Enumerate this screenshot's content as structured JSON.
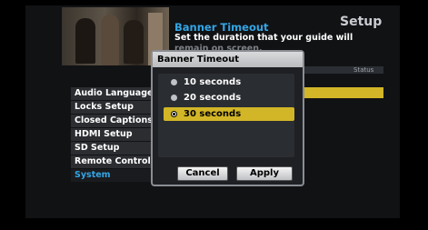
{
  "header": {
    "section_title": "Setup",
    "help_title": "Banner Timeout",
    "help_text_line1": "Set the duration that your guide will",
    "help_text_line2": "remain on screen."
  },
  "status_label": "Status",
  "menu": {
    "items": [
      {
        "label": "Audio Language"
      },
      {
        "label": "Locks Setup"
      },
      {
        "label": "Closed Captions"
      },
      {
        "label": "HDMI Setup"
      },
      {
        "label": "SD Setup"
      },
      {
        "label": "Remote Control"
      },
      {
        "label": "System"
      }
    ]
  },
  "dialog": {
    "title": "Banner Timeout",
    "options": [
      {
        "label": "10 seconds",
        "selected": false
      },
      {
        "label": "20 seconds",
        "selected": false
      },
      {
        "label": "30 seconds",
        "selected": true
      }
    ],
    "cancel_label": "Cancel",
    "apply_label": "Apply"
  },
  "colors": {
    "accent_blue": "#33a6e6",
    "selection_gold": "#d2b628",
    "background": "#000000"
  }
}
